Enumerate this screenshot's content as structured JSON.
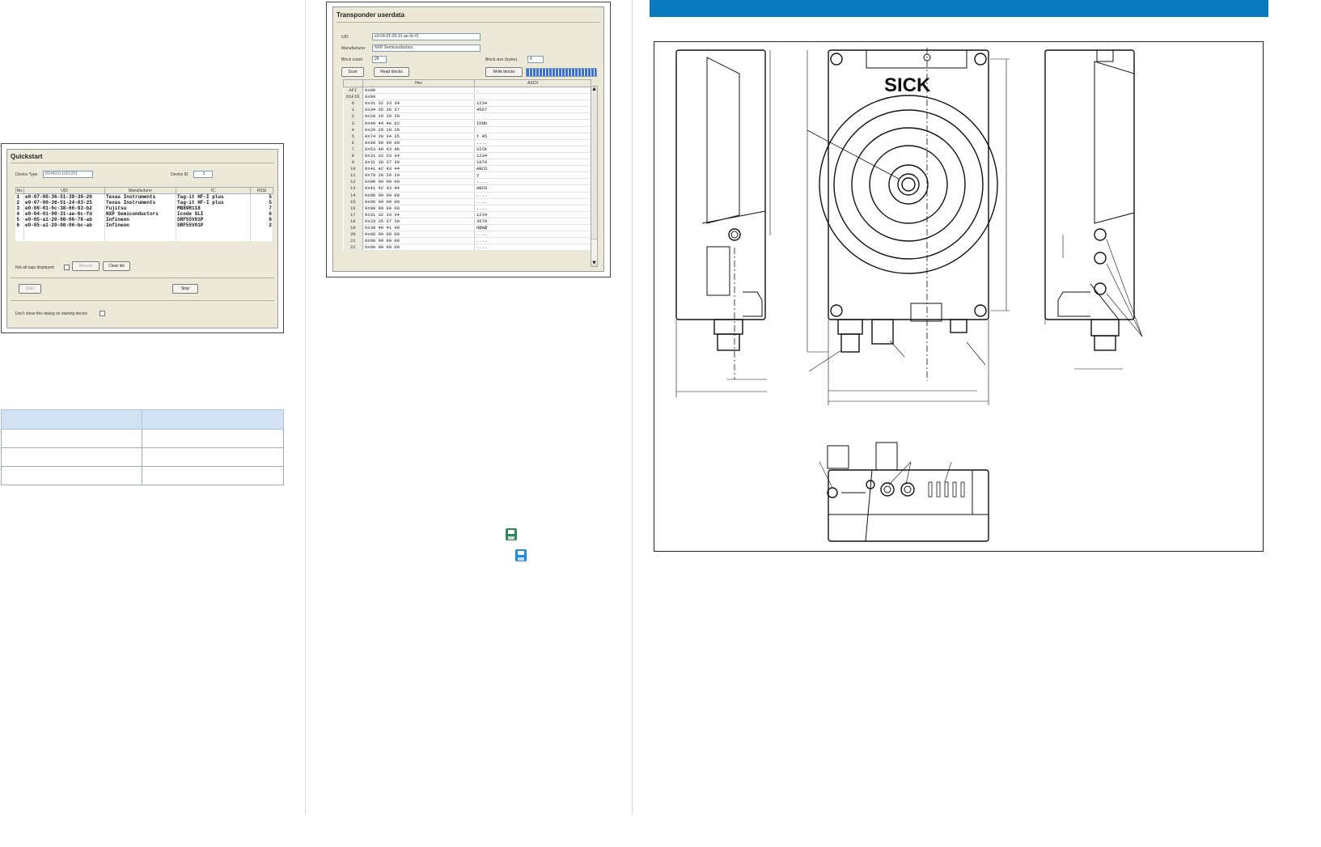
{
  "quickstart": {
    "title": "Quickstart",
    "device_type_label": "Device Type",
    "device_type_value": "RFH620-1001201",
    "device_id_label": "Device ID",
    "device_id_value": "1",
    "columns": [
      "No.",
      "UID",
      "Manufacturer",
      "IC",
      "RSSI"
    ],
    "rows": [
      [
        "1",
        "e0-07-00-36-51-39-30-20",
        "Texas Instruments",
        "Tag-it HF-I plus",
        "5"
      ],
      [
        "2",
        "e0-07-00-36-51-24-83-25",
        "Texas Instruments",
        "Tag-it HF-I plus",
        "5"
      ],
      [
        "3",
        "e0-08-01-0c-38-66-93-b2",
        "Fujitsu",
        "MB89R118",
        "7"
      ],
      [
        "4",
        "e0-04-01-00-31-ae-0c-fd",
        "NXP Semiconductors",
        "Icode SLI",
        "6"
      ],
      [
        "5",
        "e0-05-a1-20-08-06-78-ab",
        "Infineon",
        "SRF55V01P",
        "6"
      ],
      [
        "6",
        "e0-05-a1-20-08-06-bc-ab",
        "Infineon",
        "SRF55V01P",
        "2"
      ]
    ],
    "not_all_tags_label": "Not all tags displayed",
    "results_button": "Results",
    "clear_list_button": "Clear list",
    "start_button": "Start",
    "stop_button": "Stop",
    "dont_show_label": "Don't show this dialog on starting device"
  },
  "transponder": {
    "title": "Transponder userdata",
    "uid_label": "UID",
    "uid_value": "e0-04-01-00-31-ae-0c-f2",
    "manufacturer_label": "Manufacturer",
    "manufacturer_value": "NXP Semiconductors",
    "block_count_label": "Block count",
    "block_count_value": "28",
    "block_size_label": "Block size (bytes)",
    "block_size_value": "4",
    "scan_button": "Scan",
    "read_button": "Read blocks",
    "write_button": "Write blocks",
    "columns": [
      "",
      "Hex",
      "ASCII"
    ],
    "rows": [
      [
        "AFI",
        "0x00",
        "."
      ],
      [
        "DSFID",
        "0x00",
        ""
      ],
      [
        "0",
        "0x31 32 33 34",
        "1234"
      ],
      [
        "1",
        "0x34 35 36 37",
        "4567"
      ],
      [
        "2",
        "0x20 20 20 20",
        ""
      ],
      [
        "3",
        "0x49 44 4e 62",
        "IDNb"
      ],
      [
        "4",
        "0x20 20 20 20",
        ""
      ],
      [
        "5",
        "0x74 20 34 35",
        "t 45"
      ],
      [
        "6",
        "0x00 00 00 00",
        "...."
      ],
      [
        "7",
        "0x53 49 43 4b",
        "SICK"
      ],
      [
        "8",
        "0x31 32 33 34",
        "1234"
      ],
      [
        "9",
        "0x31 30 37 39",
        "1079"
      ],
      [
        "10",
        "0x41 42 43 44",
        "ABCD"
      ],
      [
        "11",
        "0x79 20 20 20",
        "y"
      ],
      [
        "12",
        "0x00 00 00 00",
        "...."
      ],
      [
        "13",
        "0x41 42 43 44",
        "ABCD"
      ],
      [
        "14",
        "0x00 00 00 00",
        "...."
      ],
      [
        "15",
        "0x00 00 00 00",
        "...."
      ],
      [
        "16",
        "0x00 00 00 00",
        "...."
      ],
      [
        "17",
        "0x31 32 33 34",
        "1234"
      ],
      [
        "18",
        "0x33 35 37 39",
        "3579"
      ],
      [
        "19",
        "0x39 40 41 40",
        "9@A@"
      ],
      [
        "20",
        "0x00 00 00 00",
        "...."
      ],
      [
        "21",
        "0x00 00 00 00",
        "...."
      ],
      [
        "22",
        "0x00 00 00 00",
        "...."
      ]
    ]
  },
  "drawing": {
    "brand": "SICK"
  },
  "colors": {
    "header_blue": "#0a7abf",
    "table_header": "#d3e2f2",
    "icon_save_green": "#2e8b57",
    "icon_save_blue": "#1e88e5"
  },
  "icons": [
    "save-icon",
    "save-as-icon"
  ]
}
